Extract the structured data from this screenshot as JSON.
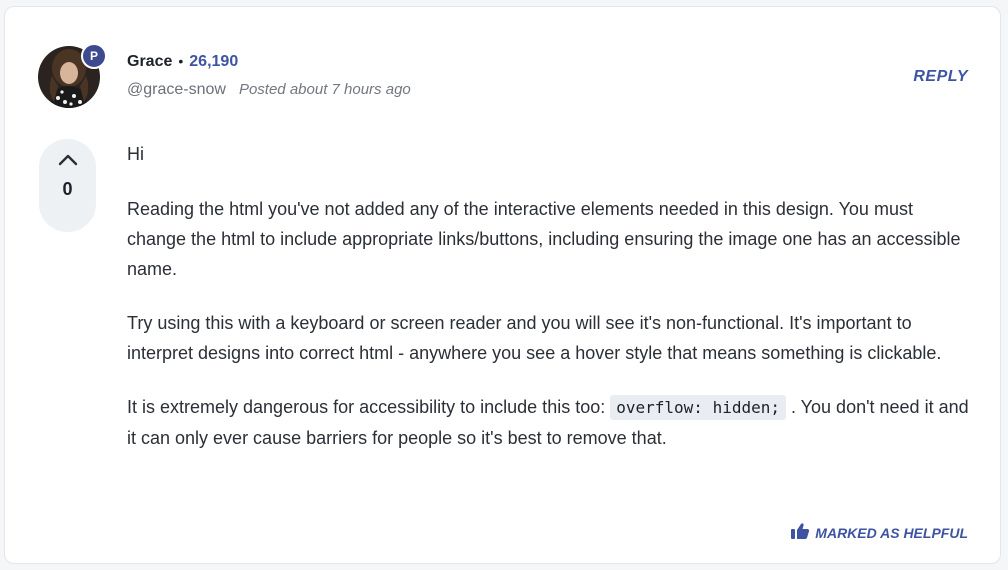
{
  "author": {
    "name": "Grace",
    "separator": "•",
    "reputation": "26,190",
    "handle": "@grace-snow",
    "posted": "Posted about 7 hours ago",
    "badge": "P"
  },
  "actions": {
    "reply_label": "REPLY",
    "helpful_label": "MARKED AS HELPFUL",
    "helpful_icon": "thumbs-up-icon"
  },
  "vote": {
    "count": "0",
    "icon": "chevron-up-icon"
  },
  "comment": {
    "greeting": "Hi",
    "paragraph1": "Reading the html you've not added any of the interactive elements needed in this design. You must change the html to include appropriate links/buttons, including ensuring the image one has an accessible name.",
    "paragraph2": "Try using this with a keyboard or screen reader and you will see it's non-functional. It's important to interpret designs into correct html - anywhere you see a hover style that means something is clickable.",
    "paragraph3_before": "It is extremely dangerous for accessibility to include this too: ",
    "paragraph3_code": "overflow: hidden;",
    "paragraph3_after": " . You don't need it and it can only ever cause barriers for people so it's best to remove that."
  },
  "colors": {
    "accent": "#3e54a3",
    "badge": "#3d4a8f",
    "text": "#2b2f36",
    "card": "#ffffff",
    "background": "#f4f6f8"
  }
}
